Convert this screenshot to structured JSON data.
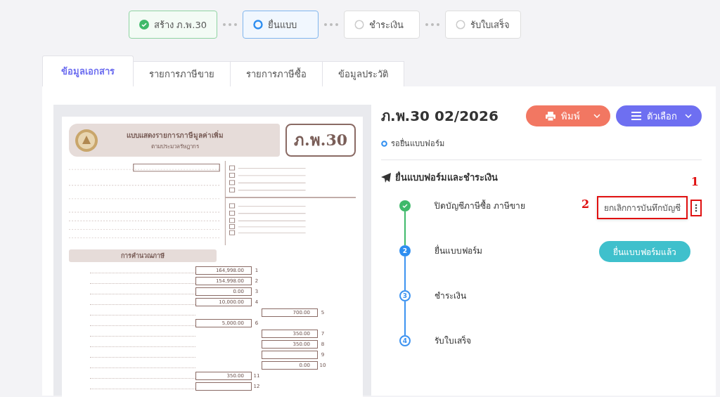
{
  "stepper": [
    {
      "label": "สร้าง ภ.พ.30",
      "kind": "done"
    },
    {
      "label": "ยื่นแบบ",
      "kind": "current"
    },
    {
      "label": "ชำระเงิน",
      "kind": "pending"
    },
    {
      "label": "รับใบเสร็จ",
      "kind": "pending"
    }
  ],
  "tabs": [
    {
      "label": "ข้อมูลเอกสาร",
      "selected": true
    },
    {
      "label": "รายการภาษีขาย",
      "selected": false
    },
    {
      "label": "รายการภาษีซื้อ",
      "selected": false
    },
    {
      "label": "ข้อมูลประวัติ",
      "selected": false
    }
  ],
  "form_preview": {
    "title": "แบบแสดงรายการภาษีมูลค่าเพิ่ม",
    "subtitle": "ตามประมวลรัษฎากร",
    "code": "ภ.พ.30",
    "section_title": "การคำนวณภาษี",
    "rows": [
      {
        "no": "1",
        "amount": "164,998.00",
        "kind": "left"
      },
      {
        "no": "2",
        "amount": "154,998.00",
        "kind": "left"
      },
      {
        "no": "3",
        "amount": "0.00",
        "kind": "left"
      },
      {
        "no": "4",
        "amount": "10,000.00",
        "kind": "left"
      },
      {
        "no": "5",
        "amount": "700.00",
        "kind": "right"
      },
      {
        "no": "6",
        "amount": "5,000.00",
        "kind": "left"
      },
      {
        "no": "7",
        "amount": "350.00",
        "kind": "right"
      },
      {
        "no": "8",
        "amount": "350.00",
        "kind": "right"
      },
      {
        "no": "9",
        "kind": "right"
      },
      {
        "no": "10",
        "amount": "0.00",
        "kind": "right"
      },
      {
        "no": "11",
        "amount": "350.00",
        "kind": "left"
      },
      {
        "no": "12",
        "kind": "left"
      }
    ]
  },
  "document": {
    "title": "ภ.พ.30 02/2026",
    "status": "รอยื่นแบบฟอร์ม",
    "print_button": "พิมพ์",
    "options_button": "ตัวเลือก"
  },
  "section": {
    "title": "ยื่นแบบฟอร์มและชำระเงิน",
    "steps": [
      {
        "label": "ปิดบัญชีภาษีซื้อ ภาษีขาย",
        "kind": "done",
        "menu_item": "ยกเลิกการบันทึกบัญชี"
      },
      {
        "label": "ยื่นแบบฟอร์ม",
        "kind": "current",
        "number": "2",
        "action": "ยื่นแบบฟอร์มแล้ว"
      },
      {
        "label": "ชำระเงิน",
        "kind": "pending",
        "number": "3"
      },
      {
        "label": "รับใบเสร็จ",
        "kind": "pending",
        "number": "4"
      }
    ]
  },
  "annotations": [
    {
      "label": "1"
    },
    {
      "label": "2"
    }
  ]
}
